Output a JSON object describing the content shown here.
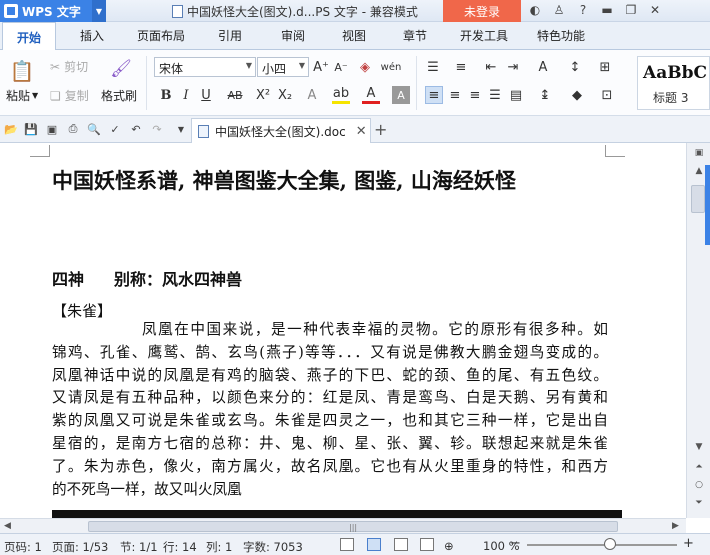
{
  "titlebar": {
    "app_name": "WPS 文字",
    "doc_title": "中国妖怪大全(图文).d...PS 文字 - 兼容模式",
    "login_label": "未登录"
  },
  "tabs": [
    {
      "label": "开始",
      "active": true
    },
    {
      "label": "插入"
    },
    {
      "label": "页面布局"
    },
    {
      "label": "引用"
    },
    {
      "label": "审阅"
    },
    {
      "label": "视图"
    },
    {
      "label": "章节"
    },
    {
      "label": "开发工具"
    },
    {
      "label": "特色功能"
    }
  ],
  "ribbon": {
    "paste_label": "粘贴",
    "cut_label": "剪切",
    "copy_label": "复制",
    "format_painter_label": "格式刷",
    "font_name": "宋体",
    "font_size": "小四",
    "style_sample": "AaBbC",
    "style_name": "标题 3"
  },
  "doc_tab": {
    "name": "中国妖怪大全(图文).doc"
  },
  "document": {
    "heading": "中国妖怪系谱, 神兽图鉴大全集, 图鉴, 山海经妖怪",
    "subheading_left": "四神",
    "subheading_right": "别称：风水四神兽",
    "section_label": "【朱雀】",
    "body_lines": [
      "凤凰在中国来说，是一种代表幸福的灵物。它的原形有很多种。如",
      "锦鸡、孔雀、鹰鹫、鹄、玄鸟(燕子)等等．．．又有说是佛教大鹏金翅鸟变成的。",
      "凤凰神话中说的凤凰是有鸡的脑袋、燕子的下巴、蛇的颈、鱼的尾、有五色纹。",
      "又请凤是有五种品种，以颜色来分的：红是凤、青是鸾鸟、白是天鹅、另有黄和",
      "紫的凤凰又可说是朱雀或玄鸟。朱雀是四灵之一，也和其它三种一样，它是出自",
      "星宿的，是南方七宿的总称：井、鬼、柳、星、张、翼、轸。联想起来就是朱雀",
      "了。朱为赤色，像火，南方属火，故名凤凰。它也有从火里重身的特性，和西方",
      "的不死鸟一样，故又叫火凤凰"
    ]
  },
  "statusbar": {
    "page_code": "页码: 1",
    "page": "页面: 1/53",
    "section": "节: 1/1",
    "row": "行: 14",
    "col": "列: 1",
    "word_count": "字数: 7053",
    "zoom": "100 %",
    "zoom_level": 1.0
  },
  "colors": {
    "accent": "#3b82e6",
    "login": "#f0674a"
  }
}
